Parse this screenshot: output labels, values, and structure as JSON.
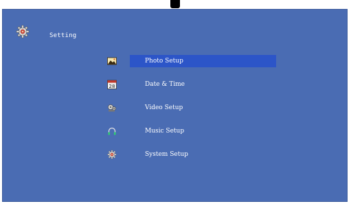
{
  "header": {
    "title": "Setting",
    "icon": "gear-icon"
  },
  "menu": {
    "selected_index": 0,
    "items": [
      {
        "label": "Photo Setup",
        "icon": "photo-icon"
      },
      {
        "label": "Date & Time",
        "icon": "calendar-icon",
        "icon_text": "28"
      },
      {
        "label": "Video Setup",
        "icon": "film-reel-icon"
      },
      {
        "label": "Music Setup",
        "icon": "headphones-icon"
      },
      {
        "label": "System Setup",
        "icon": "gear-icon"
      }
    ]
  },
  "colors": {
    "panel_background": "#4a6cb3",
    "selection_highlight": "#2c55c8",
    "text": "#ffffff"
  }
}
